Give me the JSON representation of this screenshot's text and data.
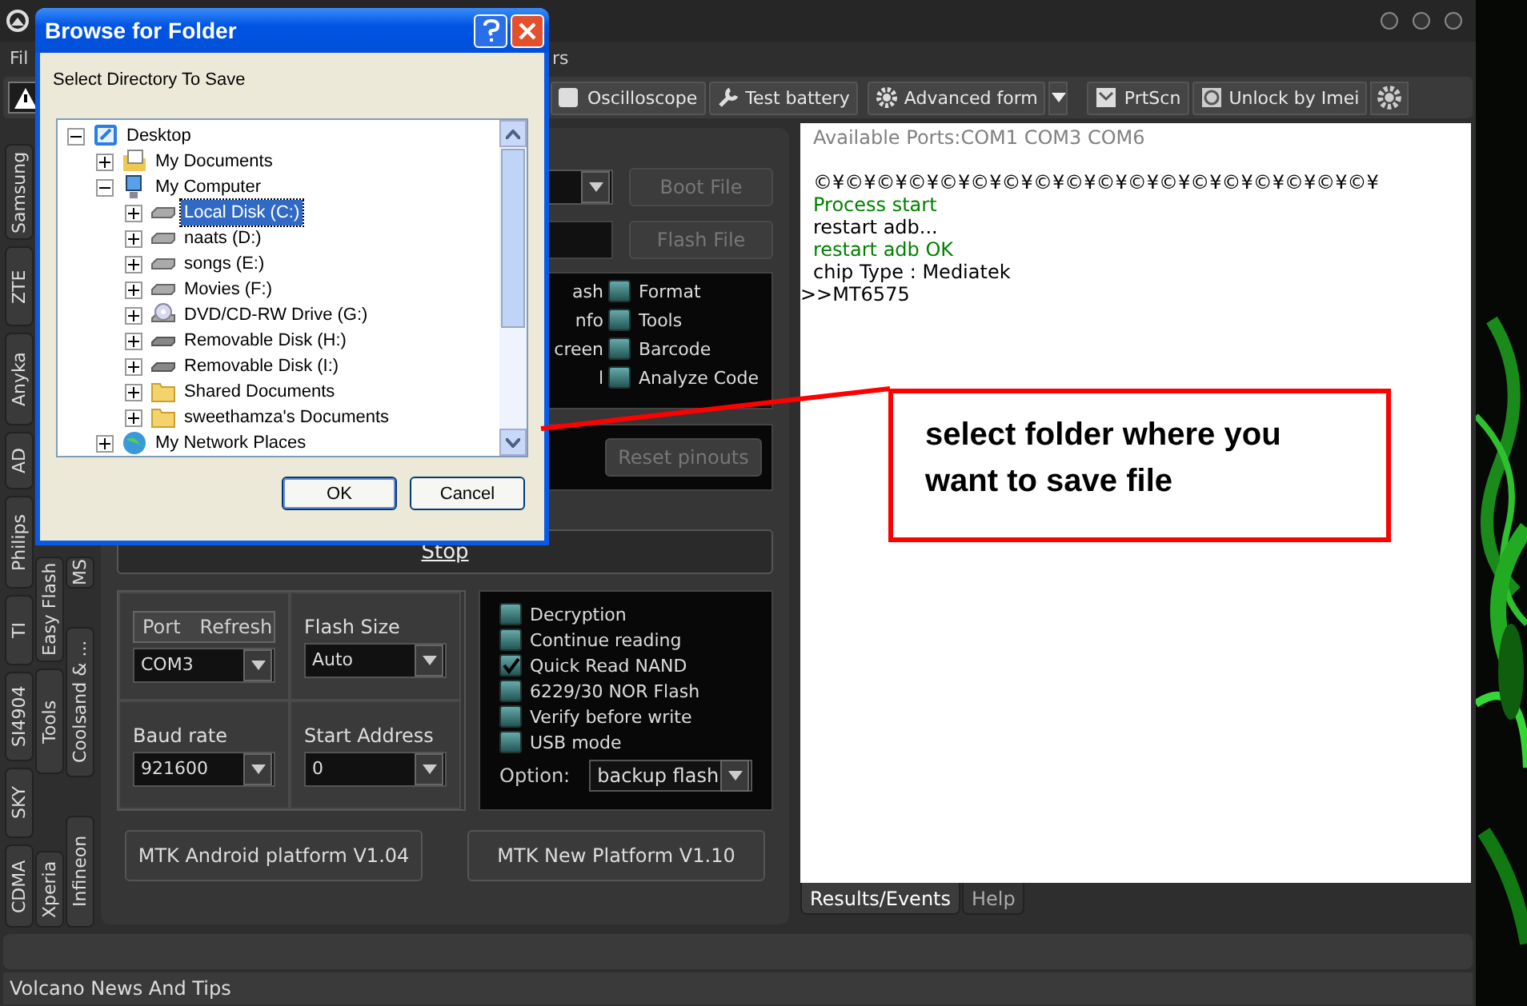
{
  "menu": [
    "Fil",
    "rs"
  ],
  "toolbar": {
    "buttons": [
      {
        "label": "Oscilloscope"
      },
      {
        "label": "Test battery"
      },
      {
        "label": "Advanced form"
      },
      {
        "label": "PrtScn"
      },
      {
        "label": "Unlock by Imei"
      }
    ]
  },
  "side_tabs": {
    "column_1": [
      "Samsung",
      "ZTE",
      "Anyka",
      "AD",
      "Philips",
      "TI",
      "SI4904",
      "SKY",
      "CDMA"
    ],
    "column_2": [
      "Easy Flash",
      "Tools",
      "Xperia"
    ],
    "column_3": [
      "MS",
      "Coolsand & ...",
      "Infineon"
    ]
  },
  "panel": {
    "boot_button": "Boot File",
    "flash_button": "Flash File",
    "cut_labels": [
      "ash",
      "nfo",
      "creen",
      "l"
    ],
    "functions": [
      {
        "label": "Format",
        "checked": false
      },
      {
        "label": "Tools",
        "checked": false
      },
      {
        "label": "Barcode",
        "checked": false
      },
      {
        "label": "Analyze Code",
        "checked": false
      }
    ],
    "reset_button": "Reset pinouts",
    "stop_button": "Stop",
    "port": {
      "label": "Port",
      "refresh": "Refresh",
      "value": "COM3"
    },
    "flash_size": {
      "label": "Flash Size",
      "value": "Auto"
    },
    "baud_rate": {
      "label": "Baud rate",
      "value": "921600"
    },
    "start_address": {
      "label": "Start Address",
      "value": "0"
    },
    "options": [
      {
        "label": "Decryption",
        "checked": false
      },
      {
        "label": "Continue reading",
        "checked": false
      },
      {
        "label": "Quick Read NAND",
        "checked": true
      },
      {
        "label": "6229/30 NOR Flash",
        "checked": false
      },
      {
        "label": "Verify before write",
        "checked": false
      },
      {
        "label": "USB mode",
        "checked": false
      }
    ],
    "option": {
      "label": "Option:",
      "value": "backup flash"
    },
    "platform_buttons": [
      "MTK Android platform V1.04",
      "MTK New Platform V1.10"
    ]
  },
  "log": {
    "header": "Available Ports:COM1 COM3 COM6",
    "lines": [
      {
        "text": "©¥©¥©¥©¥©¥©¥©¥©¥©¥©¥©¥©¥©¥©¥©¥©¥©¥©¥",
        "color": "#000000"
      },
      {
        "text": "Process start",
        "color": "#008000"
      },
      {
        "text": "restart adb...",
        "color": "#000000"
      },
      {
        "text": "restart adb OK",
        "color": "#008000"
      },
      {
        "text": "chip Type : Mediatek",
        "color": "#000000"
      },
      {
        "text": ">>MT6575",
        "color": "#000000",
        "outdent": true
      }
    ],
    "tabs": [
      {
        "label": "Results/Events",
        "selected": true
      },
      {
        "label": "Help",
        "selected": false
      }
    ]
  },
  "status_bar": "Volcano News And Tips",
  "dialog": {
    "title": "Browse for Folder",
    "prompt": "Select Directory To Save",
    "tree": [
      {
        "label": "Desktop",
        "kind": "desktop",
        "expanded": true,
        "selected": false,
        "children": [
          {
            "label": "My Documents",
            "kind": "documents",
            "expanded": false,
            "selected": false
          },
          {
            "label": "My Computer",
            "kind": "computer",
            "expanded": true,
            "selected": false,
            "children": [
              {
                "label": "Local Disk (C:)",
                "kind": "drive",
                "expanded": false,
                "selected": true
              },
              {
                "label": "naats (D:)",
                "kind": "drive",
                "expanded": false,
                "selected": false
              },
              {
                "label": "songs (E:)",
                "kind": "drive",
                "expanded": false,
                "selected": false
              },
              {
                "label": "Movies (F:)",
                "kind": "drive",
                "expanded": false,
                "selected": false
              },
              {
                "label": "DVD/CD-RW Drive (G:)",
                "kind": "cdrom",
                "expanded": false,
                "selected": false
              },
              {
                "label": "Removable Disk (H:)",
                "kind": "removable",
                "expanded": false,
                "selected": false
              },
              {
                "label": "Removable Disk (I:)",
                "kind": "removable",
                "expanded": false,
                "selected": false
              },
              {
                "label": "Shared Documents",
                "kind": "folder",
                "expanded": false,
                "selected": false
              },
              {
                "label": "sweethamza's Documents",
                "kind": "folder",
                "expanded": false,
                "selected": false
              }
            ]
          },
          {
            "label": "My Network Places",
            "kind": "network",
            "expanded": false,
            "selected": false
          }
        ]
      }
    ],
    "buttons": [
      "OK",
      "Cancel"
    ]
  },
  "callout": {
    "text": "select folder where you want to save file"
  }
}
